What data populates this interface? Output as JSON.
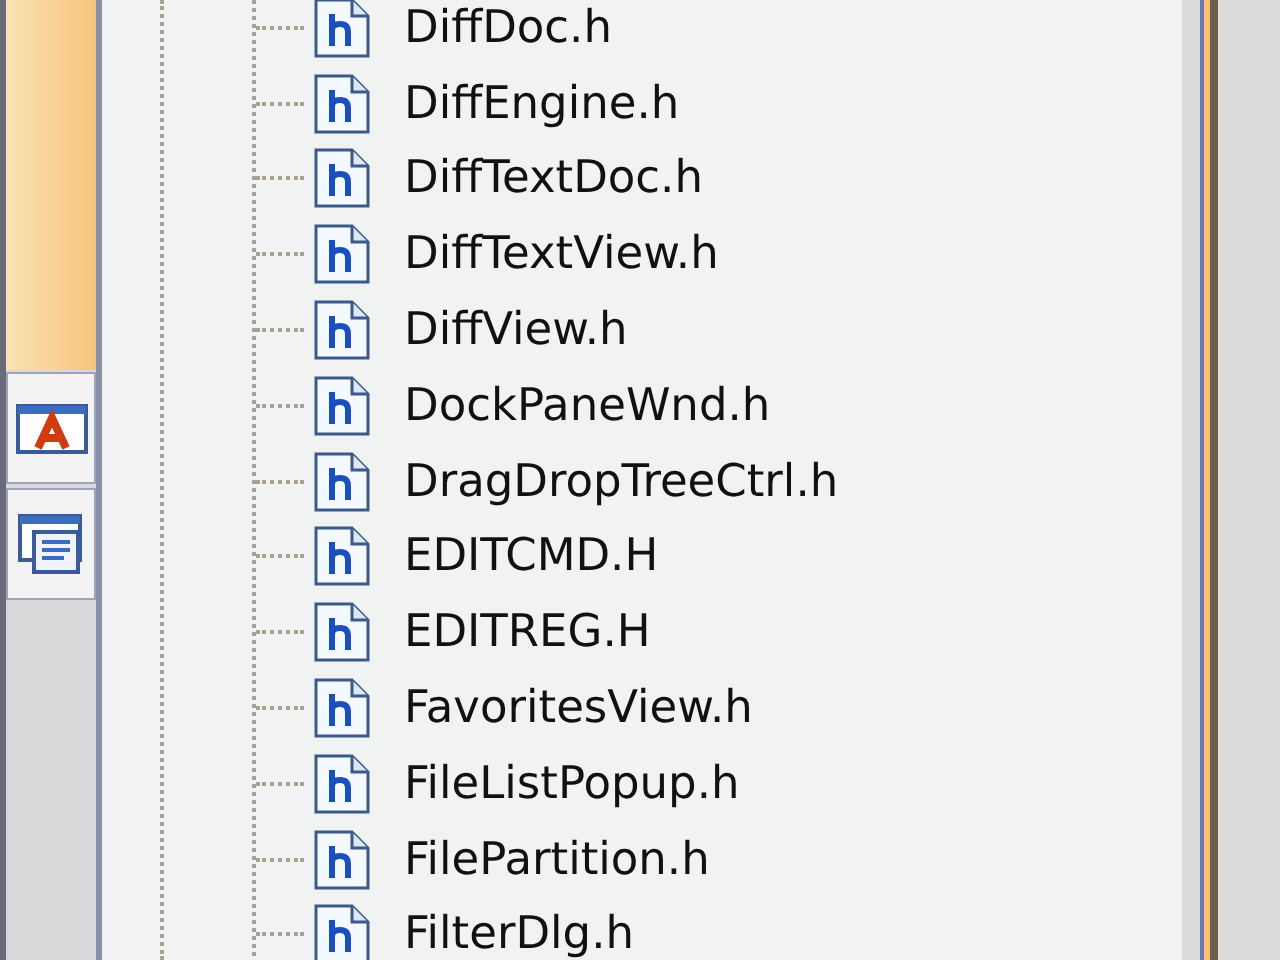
{
  "side_tabs": [
    {
      "kind": "font"
    },
    {
      "kind": "pages"
    }
  ],
  "tree": {
    "items": [
      {
        "label": "DiffDoc.h",
        "kind": "header"
      },
      {
        "label": "DiffEngine.h",
        "kind": "header"
      },
      {
        "label": "DiffTextDoc.h",
        "kind": "header"
      },
      {
        "label": "DiffTextView.h",
        "kind": "header"
      },
      {
        "label": "DiffView.h",
        "kind": "header"
      },
      {
        "label": "DockPaneWnd.h",
        "kind": "header"
      },
      {
        "label": "DragDropTreeCtrl.h",
        "kind": "header"
      },
      {
        "label": "EDITCMD.H",
        "kind": "header"
      },
      {
        "label": "EDITREG.H",
        "kind": "header"
      },
      {
        "label": "FavoritesView.h",
        "kind": "header"
      },
      {
        "label": "FileListPopup.h",
        "kind": "header"
      },
      {
        "label": "FilePartition.h",
        "kind": "header"
      },
      {
        "label": "FilterDlg.h",
        "kind": "header"
      }
    ]
  }
}
